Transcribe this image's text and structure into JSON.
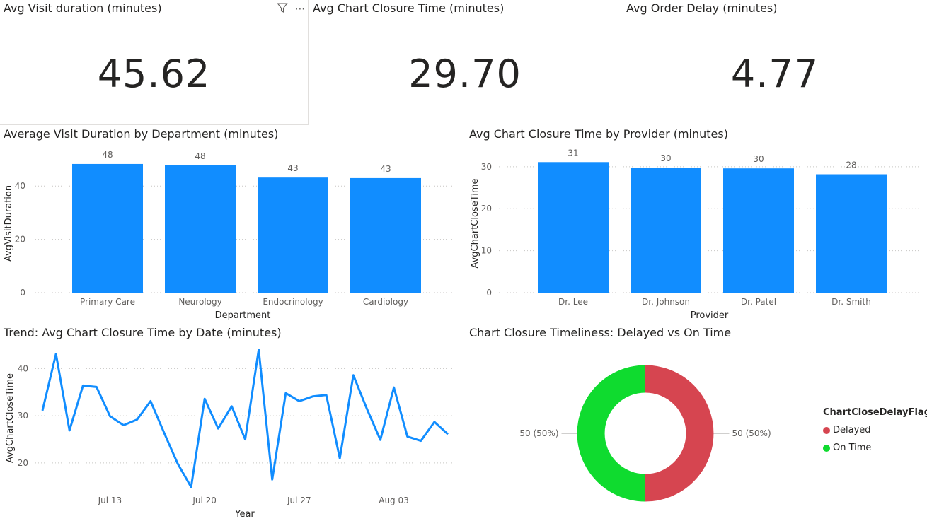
{
  "cards": [
    {
      "title": "Avg Visit duration (minutes)",
      "value": "45.62"
    },
    {
      "title": "Avg Chart Closure Time (minutes)",
      "value": "29.70"
    },
    {
      "title": "Avg Order Delay (minutes)",
      "value": "4.77"
    }
  ],
  "header_icons": {
    "filter": "filter-icon",
    "more": "more-options-icon",
    "more_glyph": "···"
  },
  "colors": {
    "bar": "#118DFF",
    "line": "#118DFF",
    "delayed": "#D64550",
    "on_time": "#0FDB2F",
    "grid": "#c8c6c4"
  },
  "chart_data": [
    {
      "id": "dept",
      "type": "bar",
      "title": "Average Visit Duration by Department (minutes)",
      "xlabel": "Department",
      "ylabel": "AvgVisitDuration",
      "categories": [
        "Primary Care",
        "Neurology",
        "Endocrinology",
        "Cardiology"
      ],
      "values": [
        48.3,
        47.8,
        43.2,
        43.0
      ],
      "data_labels": [
        "48",
        "48",
        "43",
        "43"
      ],
      "yticks": [
        "0",
        "20",
        "40"
      ],
      "ytick_values": [
        0,
        20,
        40
      ],
      "ylim": [
        0,
        52
      ],
      "grid": true
    },
    {
      "id": "prov",
      "type": "bar",
      "title": "Avg Chart Closure Time by Provider (minutes)",
      "xlabel": "Provider",
      "ylabel": "AvgChartCloseTime",
      "categories": [
        "Dr. Lee",
        "Dr. Johnson",
        "Dr. Patel",
        "Dr. Smith"
      ],
      "values": [
        31.1,
        29.8,
        29.6,
        28.2
      ],
      "data_labels": [
        "31",
        "30",
        "30",
        "28"
      ],
      "yticks": [
        "0",
        "10",
        "20",
        "30"
      ],
      "ytick_values": [
        0,
        10,
        20,
        30
      ],
      "ylim": [
        0,
        33
      ],
      "grid": true
    },
    {
      "id": "trend",
      "type": "line",
      "title": "Trend: Avg Chart Closure Time by Date (minutes)",
      "xlabel": "Year",
      "ylabel": "AvgChartCloseTime",
      "x": [
        "2024-07-09",
        "2024-07-10",
        "2024-07-11",
        "2024-07-12",
        "2024-07-13",
        "2024-07-14",
        "2024-07-15",
        "2024-07-16",
        "2024-07-17",
        "2024-07-18",
        "2024-07-19",
        "2024-07-20",
        "2024-07-21",
        "2024-07-22",
        "2024-07-23",
        "2024-07-24",
        "2024-07-25",
        "2024-07-26",
        "2024-07-27",
        "2024-07-28",
        "2024-07-29",
        "2024-07-30",
        "2024-07-31",
        "2024-08-01",
        "2024-08-02",
        "2024-08-03",
        "2024-08-04",
        "2024-08-05",
        "2024-08-06",
        "2024-08-07"
      ],
      "values": [
        31.1,
        43.1,
        26.9,
        36.4,
        36.1,
        29.9,
        28.0,
        29.2,
        33.1,
        26.4,
        19.9,
        14.9,
        33.6,
        27.3,
        32.0,
        25.0,
        44.0,
        16.5,
        34.8,
        33.1,
        34.1,
        34.4,
        21.0,
        38.6,
        31.5,
        24.9,
        36.0,
        25.6,
        24.7,
        28.7,
        26.1
      ],
      "xticks": [
        "Jul 13",
        "Jul 20",
        "Jul 27",
        "Aug 03"
      ],
      "xtick_index": [
        4,
        11,
        18,
        25
      ],
      "yticks": [
        "20",
        "30",
        "40"
      ],
      "ytick_values": [
        20,
        30,
        40
      ],
      "ylim": [
        14,
        45
      ],
      "grid": true
    },
    {
      "id": "donut",
      "type": "pie",
      "title": "Chart Closure Timeliness: Delayed vs On Time",
      "legend_title": "ChartCloseDelayFlag",
      "slices": [
        {
          "name": "Delayed",
          "value": 50,
          "label": "50 (50%)"
        },
        {
          "name": "On Time",
          "value": 50,
          "label": "50 (50%)"
        }
      ],
      "legend": "right"
    }
  ]
}
